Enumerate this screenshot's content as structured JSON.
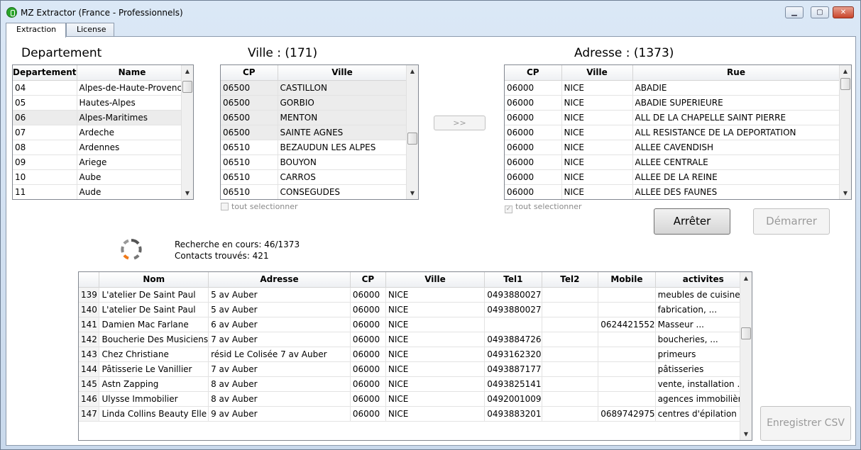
{
  "window": {
    "title": "MZ Extractor (France - Professionnels)",
    "min": "▁",
    "max": "▢",
    "close": "✕"
  },
  "tabs": [
    {
      "label": "Extraction"
    },
    {
      "label": "License"
    }
  ],
  "departement": {
    "title": "Departement",
    "columns": [
      "Departement",
      "Name"
    ],
    "rows": [
      [
        "04",
        "Alpes-de-Haute-Provence"
      ],
      [
        "05",
        "Hautes-Alpes"
      ],
      [
        "06",
        "Alpes-Maritimes"
      ],
      [
        "07",
        "Ardeche"
      ],
      [
        "08",
        "Ardennes"
      ],
      [
        "09",
        "Ariege"
      ],
      [
        "10",
        "Aube"
      ],
      [
        "11",
        "Aude"
      ]
    ]
  },
  "ville": {
    "title": "Ville : (171)",
    "columns": [
      "CP",
      "Ville"
    ],
    "rows": [
      [
        "06500",
        "CASTILLON"
      ],
      [
        "06500",
        "GORBIO"
      ],
      [
        "06500",
        "MENTON"
      ],
      [
        "06500",
        "SAINTE AGNES"
      ],
      [
        "06510",
        "BEZAUDUN LES ALPES"
      ],
      [
        "06510",
        "BOUYON"
      ],
      [
        "06510",
        "CARROS"
      ],
      [
        "06510",
        "CONSEGUDES"
      ]
    ],
    "select_all": "tout selectionner"
  },
  "transfer_button": ">>",
  "adresse": {
    "title": "Adresse : (1373)",
    "columns": [
      "CP",
      "Ville",
      "Rue"
    ],
    "rows": [
      [
        "06000",
        "NICE",
        "ABADIE"
      ],
      [
        "06000",
        "NICE",
        "ABADIE SUPERIEURE"
      ],
      [
        "06000",
        "NICE",
        "ALL DE LA CHAPELLE SAINT PIERRE"
      ],
      [
        "06000",
        "NICE",
        "ALL RESISTANCE DE LA DEPORTATION"
      ],
      [
        "06000",
        "NICE",
        "ALLEE CAVENDISH"
      ],
      [
        "06000",
        "NICE",
        "ALLEE CENTRALE"
      ],
      [
        "06000",
        "NICE",
        "ALLEE DE LA REINE"
      ],
      [
        "06000",
        "NICE",
        "ALLEE DES FAUNES"
      ]
    ],
    "select_all": "tout selectionner"
  },
  "buttons": {
    "stop": "Arrêter",
    "start": "Démarrer",
    "save_csv": "Enregistrer CSV"
  },
  "status": {
    "search": "Recherche en cours: 46/1373",
    "contacts": "Contacts trouvés: 421"
  },
  "results": {
    "columns": [
      "",
      "Nom",
      "Adresse",
      "CP",
      "Ville",
      "Tel1",
      "Tel2",
      "Mobile",
      "activites"
    ],
    "rows": [
      [
        "139",
        "L'atelier De Saint Paul",
        "5 av Auber",
        "06000",
        "NICE",
        "0493880027",
        "",
        "",
        "meubles de cuisine..."
      ],
      [
        "140",
        "L'atelier De Saint Paul",
        "5 av Auber",
        "06000",
        "NICE",
        "0493880027",
        "",
        "",
        "fabrication, ..."
      ],
      [
        "141",
        "Damien Mac Farlane",
        "6 av Auber",
        "06000",
        "NICE",
        "",
        "",
        "0624421552",
        "Masseur ..."
      ],
      [
        "142",
        "Boucherie Des Musiciens",
        "7 av Auber",
        "06000",
        "NICE",
        "0493884726",
        "",
        "",
        "boucheries, ..."
      ],
      [
        "143",
        "Chez Christiane",
        "résid Le Colisée 7 av Auber",
        "06000",
        "NICE",
        "0493162320",
        "",
        "",
        "primeurs"
      ],
      [
        "144",
        "Pâtisserie Le Vanillier",
        "7 av Auber",
        "06000",
        "NICE",
        "0493887177",
        "",
        "",
        "pâtisseries"
      ],
      [
        "145",
        "Astn Zapping",
        "8 av Auber",
        "06000",
        "NICE",
        "0493825141",
        "",
        "",
        "vente, installation ..."
      ],
      [
        "146",
        "Ulysse Immobilier",
        "8 av Auber",
        "06000",
        "NICE",
        "0492001009",
        "",
        "",
        "agences immobilières"
      ],
      [
        "147",
        "Linda Collins Beauty Elle",
        "9 av Auber",
        "06000",
        "NICE",
        "0493883201",
        "",
        "0689742975",
        "centres d'épilation"
      ]
    ]
  }
}
